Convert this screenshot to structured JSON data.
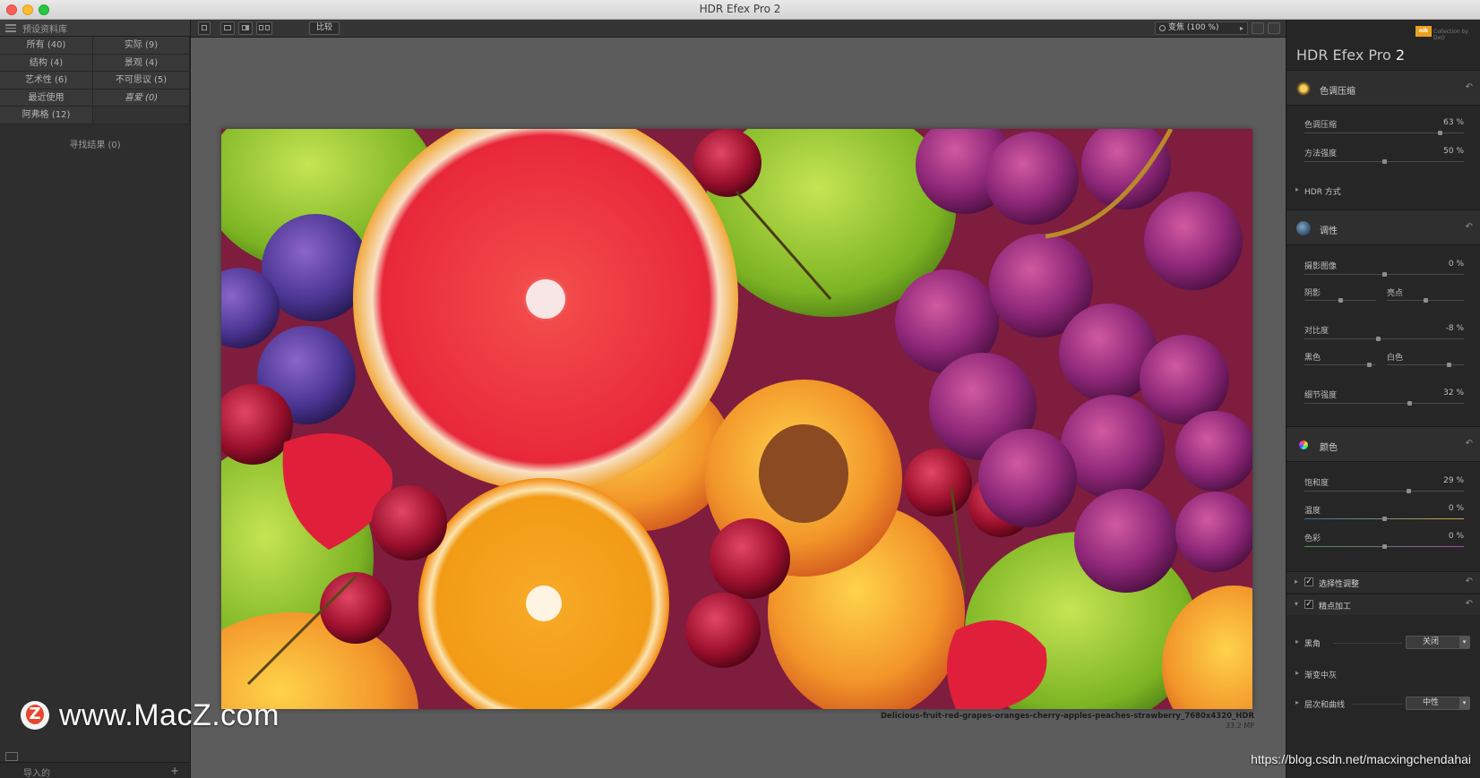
{
  "window": {
    "title": "HDR Efex Pro 2"
  },
  "left_panel": {
    "header_title": "预设资料库",
    "categories": [
      "所有 (40)",
      "实际 (9)",
      "结构 (4)",
      "景观 (4)",
      "艺术性 (6)",
      "不可思议 (5)",
      "最近使用",
      "喜爱 (0)",
      "阿弗格 (12)",
      ""
    ],
    "search_results": "寻找结果  (0)",
    "import_label": "导入的",
    "import_plus": "+"
  },
  "toolbar": {
    "compare_label": "比较",
    "zoom_label": "变焦 (100 %)",
    "zoom_arrow": "▸"
  },
  "image": {
    "filename": "Delicious-fruit-red-grapes-oranges-cherry-apples-peaches-strawberry_7680x4320_HDR",
    "megapixels": "33.2 MP"
  },
  "right_panel": {
    "brand_badge": "nik",
    "brand_text": "Collection by DxO",
    "app_name": "HDR Efex Pro",
    "app_version": "2",
    "sections": {
      "tone_compression": {
        "title": "色调压缩",
        "reset": "↶",
        "sliders": [
          {
            "label": "色调压缩",
            "value": "63 %",
            "level": 0.85
          },
          {
            "label": "方法强度",
            "value": "50 %",
            "level": 0.5
          }
        ],
        "hdr_method": "HDR 方式"
      },
      "tonality": {
        "title": "调性",
        "reset": "↶",
        "exposure": {
          "label": "摄影图像",
          "value": "0 %",
          "level": 0.5
        },
        "shadows_label": "阴影",
        "shadows_level": 0.5,
        "highlights_label": "亮点",
        "highlights_level": 0.5,
        "contrast": {
          "label": "对比度",
          "value": "-8 %",
          "level": 0.46
        },
        "blacks_label": "黑色",
        "blacks_level": 0.9,
        "whites_label": "白色",
        "whites_level": 0.8,
        "structure": {
          "label": "细节强度",
          "value": "32 %",
          "level": 0.66
        }
      },
      "color": {
        "title": "颜色",
        "reset": "↶",
        "saturation": {
          "label": "饱和度",
          "value": "29 %",
          "level": 0.65
        },
        "temperature": {
          "label": "温度",
          "value": "0 %",
          "level": 0.5
        },
        "tint": {
          "label": "色彩",
          "value": "0 %",
          "level": 0.5
        }
      },
      "selective": {
        "title": "选择性调整",
        "check": "✓",
        "reset": "↶"
      },
      "finishing": {
        "title": "精点加工",
        "check": "✓",
        "reset": "↶",
        "vignette_label": "黑角",
        "vignette_value": "关闭",
        "graduated_label": "渐变中灰",
        "levels_label": "层次和曲线",
        "levels_value": "中性"
      }
    }
  },
  "watermarks": {
    "site": "www.MacZ.com",
    "logo_letter": "Z",
    "csdn": "https://blog.csdn.net/macxingchendahai"
  },
  "colors": {
    "accent_brand": "#e8a21f",
    "panel_bg": "#262626",
    "canvas_bg": "#5c5c5c"
  }
}
